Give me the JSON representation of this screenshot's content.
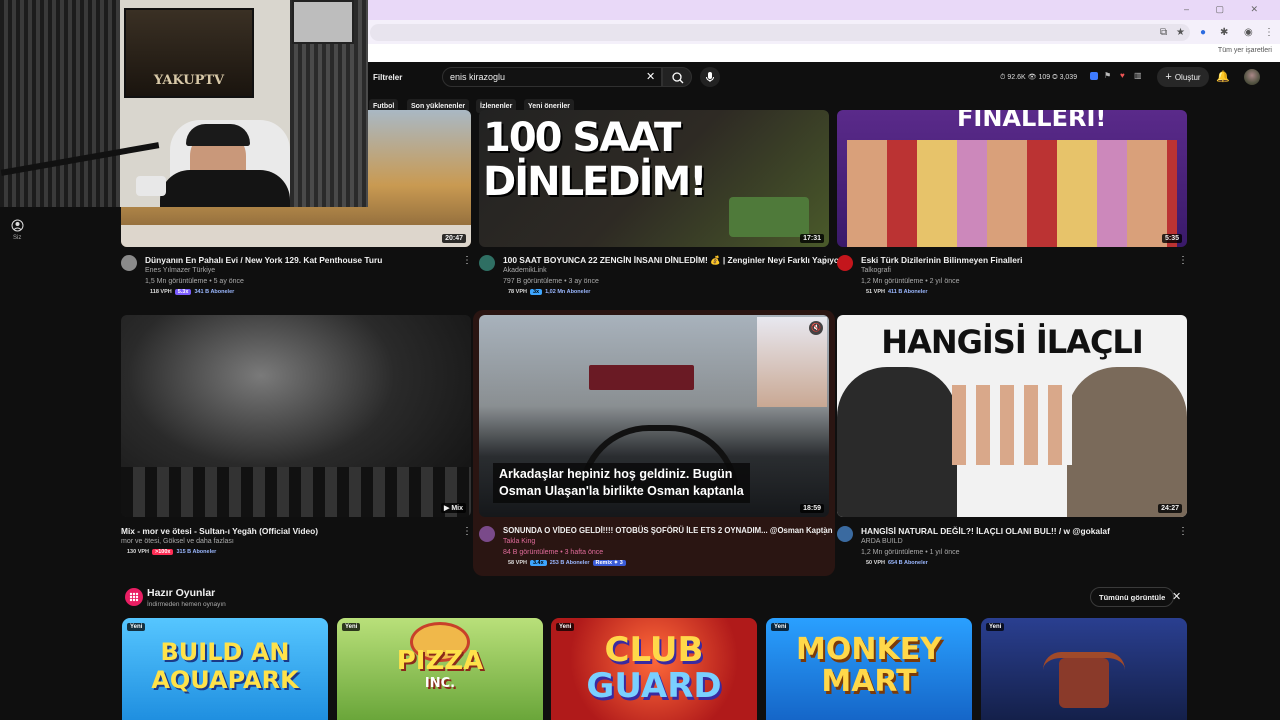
{
  "browser": {
    "bookmarks_label": "Tüm yer işaretleri",
    "window_controls": "– ▢ ✕"
  },
  "topbar": {
    "filters_label": "Filtreler",
    "search_value": "enis kirazoglu",
    "stats": "⏱ 92.6K  👁 109  ◎ 3,039",
    "create_label": "Oluştur",
    "create_icon": "plus-icon"
  },
  "chips": [
    "Futbol",
    "Son yüklenenler",
    "İzlenenler",
    "Yeni öneriler"
  ],
  "sidebar": {
    "you_label": "Siz"
  },
  "videos": [
    {
      "title": "Dünyanın En Pahalı Evi / New York 129. Kat Penthouse Turu",
      "channel": "Enes Yılmazer Türkiye",
      "meta": "1,5 Mn görüntüleme • 5 ay önce",
      "duration": "20:47",
      "vph": "118 VPH",
      "mult": "5.3x",
      "subs": "341 B Aboneler",
      "avatar_color": "#8a8a8a"
    },
    {
      "title": "100 SAAT BOYUNCA 22 ZENGİN İNSANI DİNLEDİM! 💰 | Zenginler Neyi Farklı Yapıyor?",
      "channel": "AkademikLink",
      "meta": "797 B görüntüleme • 3 ay önce",
      "duration": "17:31",
      "vph": "78 VPH",
      "mult": "3x",
      "subs": "1,02 Mn Aboneler",
      "avatar_color": "#2f6f63"
    },
    {
      "title": "Eski Türk Dizilerinin Bilinmeyen Finalleri",
      "channel": "Talkografi",
      "meta": "1,2 Mn görüntüleme • 2 yıl önce",
      "duration": "5:35",
      "vph": "51 VPH",
      "mult": "",
      "subs": "411 B Aboneler",
      "avatar_color": "#c4161c"
    },
    {
      "title": "Mix - mor ve ötesi - Sultan-ı Yegâh (Official Video)",
      "channel": "mor ve ötesi, Göksel ve daha fazlası",
      "meta": "",
      "duration": "▶ Mix",
      "vph": "130 VPH",
      "mult": ">100x",
      "subs": "315 B Aboneler",
      "avatar_color": ""
    },
    {
      "title": "SONUNDA O VİDEO GELDİ!!!! OTOBÜS ŞOFÖRÜ İLE ETS 2 OYNADIM... @Osman Kaptan",
      "channel": "Takla King",
      "meta": "84 B görüntüleme • 3 hafta önce",
      "duration": "18:59",
      "vph": "58 VPH",
      "mult": "3.4x",
      "subs": "253 B Aboneler",
      "remix": "Remix ✦ 3",
      "avatar_color": "#7a4a8a",
      "caption_line1": "Arkadaşlar hepiniz hoş geldiniz. Bugün",
      "caption_line2": "Osman Ulaşan'la birlikte Osman kaptanla"
    },
    {
      "title": "HANGİSİ NATURAL DEĞİL?! İLAÇLI OLANI BUL!! / w @gokalaf",
      "channel": "ARDA BUILD",
      "meta": "1,2 Mn görüntüleme • 1 yıl önce",
      "duration": "24:27",
      "vph": "50 VPH",
      "mult": "",
      "subs": "654 B Aboneler",
      "avatar_color": "#3a6aa0"
    }
  ],
  "thumb_text": {
    "v2_line1": "100 SAAT",
    "v2_line2": "DİNLEDİM!",
    "v3_top": "FİNALLERİ!",
    "v6_title": "HANGİSİ İLAÇLI",
    "webcam_poster": "YAKUPTV"
  },
  "games_section": {
    "title": "Hazır Oyunlar",
    "subtitle": "İndirmeden hemen oynayın",
    "show_all": "Tümünü görüntüle",
    "new_tag": "Yeni",
    "games": [
      {
        "line1": "BUILD AN",
        "line2": "AQUAPARK",
        "bg": "#3db4ff"
      },
      {
        "line1": "PIZZA",
        "line2": "INC.",
        "bg": "#8ccf5a"
      },
      {
        "line1": "CLUB",
        "line2": "GUARD",
        "bg": "#d8362b"
      },
      {
        "line1": "MONKEY",
        "line2": "MART",
        "bg": "#2a8fe0"
      },
      {
        "line1": "",
        "line2": "",
        "bg": "#243a8a"
      }
    ]
  }
}
